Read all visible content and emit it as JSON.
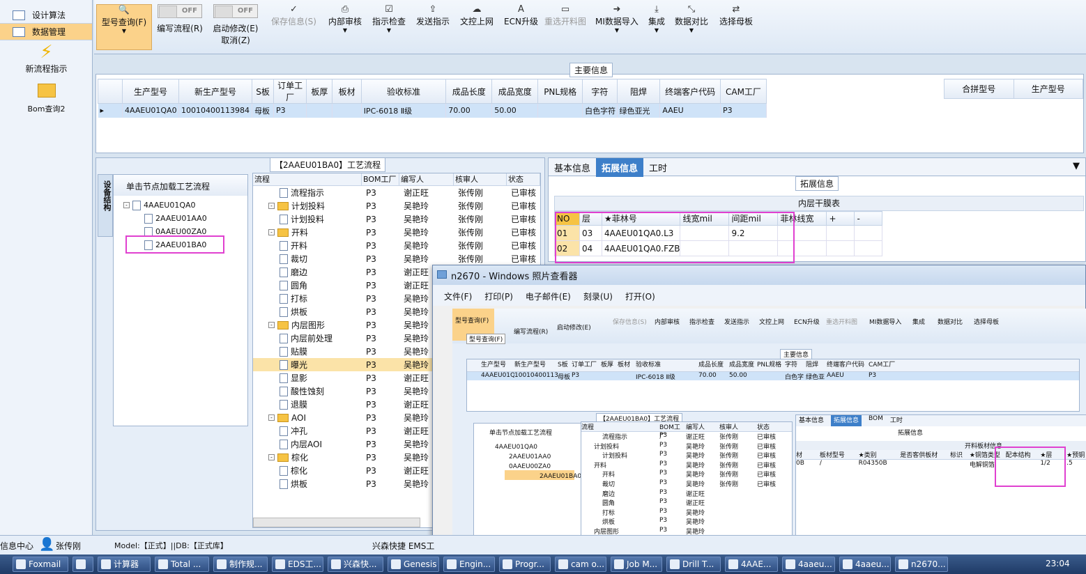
{
  "nav": {
    "items": [
      {
        "label": "设计算法"
      },
      {
        "label": "数据管理"
      }
    ],
    "new_flow": "新流程指示",
    "bom": "Bom查询2"
  },
  "toolbar": {
    "model_query": "型号查询(F)",
    "toggle_off": "OFF",
    "write_flow": "编写流程(R)",
    "start_edit": "启动修改(E)",
    "cancel": "取消(Z)",
    "save": "保存信息(S)",
    "internal_review": "内部审核",
    "instruction_check": "指示检查",
    "send": "发送指示",
    "upload": "文控上网",
    "ecn": "ECN升级",
    "reselect": "重选开料图",
    "mi_import": "MI数据导入",
    "integrate": "集成",
    "compare": "数据对比",
    "mother": "选择母板"
  },
  "main": {
    "title": "主要信息",
    "columns": [
      "生产型号",
      "新生产型号",
      "S板",
      "订单工厂",
      "板厚",
      "板材",
      "验收标准",
      "成品长度",
      "成品宽度",
      "PNL规格",
      "字符",
      "阻焊",
      "终端客户代码",
      "CAM工厂"
    ],
    "row": [
      "4AAEU01QA0",
      "10010400113984",
      "母板",
      "P3",
      "",
      "",
      "IPC-6018 Ⅱ级",
      "70.00",
      "50.00",
      "",
      "白色字符",
      "绿色亚光",
      "AAEU",
      "P3"
    ],
    "merge_cols": [
      "合拼型号",
      "生产型号"
    ]
  },
  "flow": {
    "title": "【2AAEU01BA0】工艺流程",
    "side_tab": "设备结构",
    "hint": "单击节点加载工艺流程",
    "tree": [
      "4AAEU01QA0",
      "2AAEU01AA0",
      "0AAEU00ZA0",
      "2AAEU01BA0"
    ],
    "columns": [
      "流程",
      "BOM工厂",
      "编写人",
      "核审人",
      "状态"
    ],
    "rows": [
      {
        "n": "流程指示",
        "f": "P3",
        "w": "谢正旺",
        "r": "张传刚",
        "s": "已审核",
        "lvl": 1
      },
      {
        "n": "计划投料",
        "f": "P3",
        "w": "吴艳玲",
        "r": "张传刚",
        "s": "已审核",
        "lvl": 0
      },
      {
        "n": "计划投料",
        "f": "P3",
        "w": "吴艳玲",
        "r": "张传刚",
        "s": "已审核",
        "lvl": 1
      },
      {
        "n": "开料",
        "f": "P3",
        "w": "吴艳玲",
        "r": "张传刚",
        "s": "已审核",
        "lvl": 0
      },
      {
        "n": "开料",
        "f": "P3",
        "w": "吴艳玲",
        "r": "张传刚",
        "s": "已审核",
        "lvl": 1
      },
      {
        "n": "裁切",
        "f": "P3",
        "w": "吴艳玲",
        "r": "张传刚",
        "s": "已审核",
        "lvl": 1
      },
      {
        "n": "磨边",
        "f": "P3",
        "w": "谢正旺",
        "r": "",
        "s": "",
        "lvl": 1
      },
      {
        "n": "圆角",
        "f": "P3",
        "w": "谢正旺",
        "r": "",
        "s": "",
        "lvl": 1
      },
      {
        "n": "打标",
        "f": "P3",
        "w": "吴艳玲",
        "r": "",
        "s": "",
        "lvl": 1
      },
      {
        "n": "烘板",
        "f": "P3",
        "w": "吴艳玲",
        "r": "",
        "s": "",
        "lvl": 1
      },
      {
        "n": "内层图形",
        "f": "P3",
        "w": "吴艳玲",
        "r": "",
        "s": "",
        "lvl": 0
      },
      {
        "n": "内层前处理",
        "f": "P3",
        "w": "吴艳玲",
        "r": "",
        "s": "",
        "lvl": 1
      },
      {
        "n": "贴膜",
        "f": "P3",
        "w": "吴艳玲",
        "r": "",
        "s": "",
        "lvl": 1
      },
      {
        "n": "曝光",
        "f": "P3",
        "w": "吴艳玲",
        "r": "",
        "s": "",
        "lvl": 1
      },
      {
        "n": "显影",
        "f": "P3",
        "w": "谢正旺",
        "r": "",
        "s": "",
        "lvl": 1
      },
      {
        "n": "酸性蚀刻",
        "f": "P3",
        "w": "吴艳玲",
        "r": "",
        "s": "",
        "lvl": 1
      },
      {
        "n": "退膜",
        "f": "P3",
        "w": "谢正旺",
        "r": "",
        "s": "",
        "lvl": 1
      },
      {
        "n": "AOI",
        "f": "P3",
        "w": "吴艳玲",
        "r": "",
        "s": "",
        "lvl": 0
      },
      {
        "n": "冲孔",
        "f": "P3",
        "w": "谢正旺",
        "r": "",
        "s": "",
        "lvl": 1
      },
      {
        "n": "内层AOI",
        "f": "P3",
        "w": "吴艳玲",
        "r": "",
        "s": "",
        "lvl": 1
      },
      {
        "n": "棕化",
        "f": "P3",
        "w": "吴艳玲",
        "r": "",
        "s": "",
        "lvl": 0
      },
      {
        "n": "棕化",
        "f": "P3",
        "w": "谢正旺",
        "r": "",
        "s": "",
        "lvl": 1
      },
      {
        "n": "烘板",
        "f": "P3",
        "w": "吴艳玲",
        "r": "",
        "s": "",
        "lvl": 1
      }
    ]
  },
  "ext": {
    "tabs": [
      "基本信息",
      "拓展信息",
      "工时"
    ],
    "title": "拓展信息",
    "sub": "内层干膜表",
    "columns": [
      "NO",
      "层",
      "★菲林号",
      "线宽mil",
      "间距mil",
      "菲林线宽",
      "+",
      "-"
    ],
    "rows": [
      [
        "01",
        "03",
        "4AAEU01QA0.L3",
        "",
        "9.2",
        "",
        "",
        ""
      ],
      [
        "02",
        "04",
        "4AAEU01QA0.FZB",
        "",
        "",
        "",
        "",
        ""
      ]
    ]
  },
  "viewer": {
    "title": "n2670 - Windows 照片查看器",
    "menu": [
      "文件(F)",
      "打印(P)",
      "电子邮件(E)",
      "刻录(U)",
      "打开(O)"
    ],
    "tooltip": "型号查询(F)",
    "tabs": [
      "基本信息",
      "拓展信息",
      "BOM",
      "工时"
    ],
    "ext_title": "拓展信息",
    "sub": "开料板材信息",
    "columns": [
      "材",
      "板材型号",
      "★类别",
      "是否客供板材",
      "标识",
      "★铜箔类型",
      "配本结构",
      "★层",
      "★预铜"
    ],
    "row": [
      "0B",
      "/",
      "R04350B",
      "",
      "",
      "电解铜箔",
      "",
      "1/2",
      ".5"
    ]
  },
  "status": {
    "info": "信息中心",
    "user": "张传刚",
    "model": "Model:【正式】||DB:【正式库】",
    "company": "兴森快捷 EMS工"
  },
  "taskbar": {
    "items": [
      "Foxmail",
      "",
      "计算器",
      "Total ...",
      "制作规...",
      "EDS工...",
      "兴森快...",
      "Genesis",
      "Engin...",
      "Progr...",
      "cam o...",
      "Job M...",
      "Drill T...",
      "4AAE...",
      "4aaeu...",
      "4aaeu...",
      "n2670..."
    ],
    "time": "23:04"
  }
}
